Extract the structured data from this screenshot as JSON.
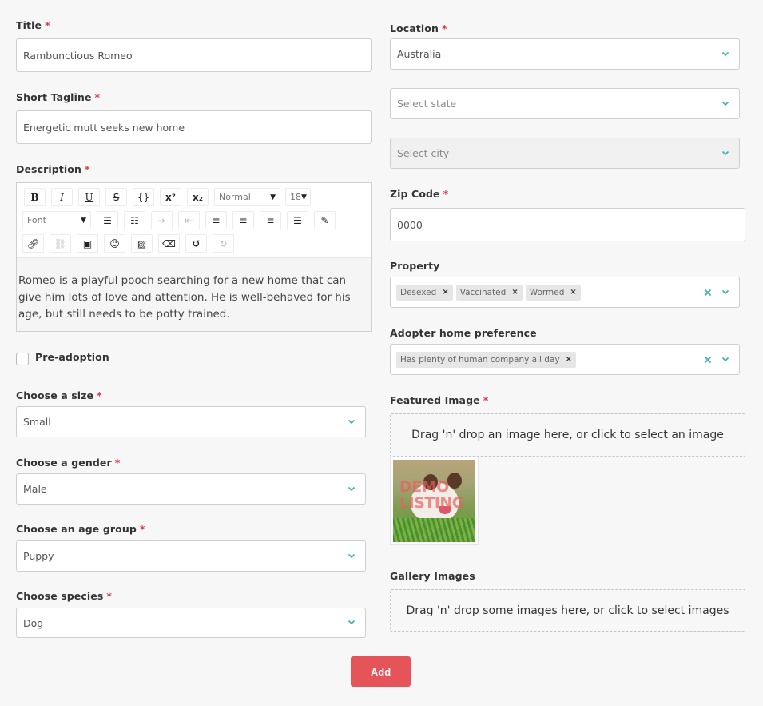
{
  "left": {
    "title": {
      "label": "Title",
      "value": "Rambunctious Romeo"
    },
    "tagline": {
      "label": "Short Tagline",
      "value": "Energetic mutt seeks new home"
    },
    "description": {
      "label": "Description",
      "toolbar": {
        "bold": "B",
        "italic": "I",
        "underline": "U",
        "strike": "S",
        "code": "{}",
        "superscript": "x²",
        "subscript": "x₂",
        "block_format": "Normal",
        "font_size": "18",
        "font": "Font"
      },
      "content": "Romeo is a playful pooch searching for a new home that can give him lots of love and attention. He is well-behaved for his age, but still needs to be potty trained."
    },
    "pre_adoption": {
      "label": "Pre-adoption",
      "checked": false
    },
    "size": {
      "label": "Choose a size",
      "value": "Small"
    },
    "gender": {
      "label": "Choose a gender",
      "value": "Male"
    },
    "age_group": {
      "label": "Choose an age group",
      "value": "Puppy"
    },
    "species": {
      "label": "Choose species",
      "value": "Dog"
    }
  },
  "right": {
    "location": {
      "label": "Location",
      "country": "Australia",
      "state_placeholder": "Select state",
      "city_placeholder": "Select city"
    },
    "zip": {
      "label": "Zip Code",
      "value": "0000"
    },
    "property": {
      "label": "Property",
      "tags": [
        "Desexed",
        "Vaccinated",
        "Wormed"
      ]
    },
    "home_pref": {
      "label": "Adopter home preference",
      "tags": [
        "Has plenty of human company all day"
      ]
    },
    "featured": {
      "label": "Featured Image",
      "dropzone": "Drag 'n' drop an image here, or click to select an image",
      "watermark_line1": "DEMO",
      "watermark_line2": "LISTING"
    },
    "gallery": {
      "label": "Gallery Images",
      "dropzone": "Drag 'n' drop some images here, or click to select images"
    }
  },
  "required_mark": "*",
  "add_button": "Add",
  "colors": {
    "accent": "#3ab0b0",
    "button": "#e55459",
    "required": "#e0384a"
  }
}
